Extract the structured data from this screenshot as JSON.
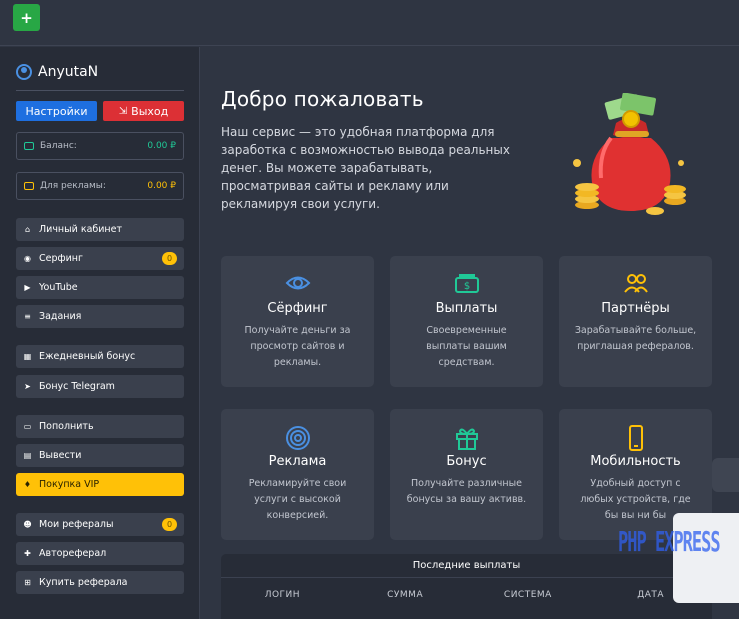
{
  "topbar": {
    "plus_label": "+"
  },
  "sidebar": {
    "username": "AnyutaN",
    "settings_label": "Настройки",
    "exit_label": "Выход",
    "balance_label": "Баланс:",
    "balance_value": "0.00 ₽",
    "ads_label": "Для рекламы:",
    "ads_value": "0.00 ₽",
    "menu": {
      "cabinet": "Личный кабинет",
      "surfing": "Серфинг",
      "surfing_badge": "0",
      "youtube": "YouTube",
      "tasks": "Задания",
      "daily_bonus": "Ежедневный бонус",
      "telegram_bonus": "Бонус Telegram",
      "deposit": "Пополнить",
      "withdraw": "Вывести",
      "buy_vip": "Покупка VIP",
      "my_referrals": "Мои рефералы",
      "my_referrals_badge": "0",
      "autoreferral": "Автореферал",
      "buy_referral": "Купить реферала"
    }
  },
  "main": {
    "title": "Добро пожаловать",
    "text": "Наш сервис — это удобная платформа для заработка с возможностью вывода реальных денег. Вы можете зарабатывать, просматривая сайты и рекламу или рекламируя свои услуги.",
    "cards": [
      {
        "title": "Сёрфинг",
        "desc": "Получайте деньги за просмотр сайтов и рекламы.",
        "icon": "eye-icon"
      },
      {
        "title": "Выплаты",
        "desc": "Своевременные выплаты вашим средствам.",
        "icon": "money-icon"
      },
      {
        "title": "Партнёры",
        "desc": "Зарабатывайте больше, приглашая рефералов.",
        "icon": "users-icon"
      },
      {
        "title": "Реклама",
        "desc": "Рекламируйте свои услуги с высокой конверсией.",
        "icon": "target-icon"
      },
      {
        "title": "Бонус",
        "desc": "Получайте различные бонусы за вашу активв.",
        "icon": "gift-icon"
      },
      {
        "title": "Мобильность",
        "desc": "Удобный доступ с любых устройств, где бы вы ни бы",
        "icon": "phone-icon"
      }
    ],
    "payouts": {
      "title": "Последние выплаты",
      "columns": [
        "ЛОГИН",
        "СУММА",
        "СИСТЕМА",
        "ДАТА"
      ]
    }
  },
  "overlay": {
    "watermark": "PHP EXPRESS"
  },
  "colors": {
    "accent_green": "#20c997",
    "accent_yellow": "#ffc107",
    "accent_blue": "#4a90e2",
    "exit_red": "#dc3035",
    "settings_blue": "#1e6fe0"
  }
}
